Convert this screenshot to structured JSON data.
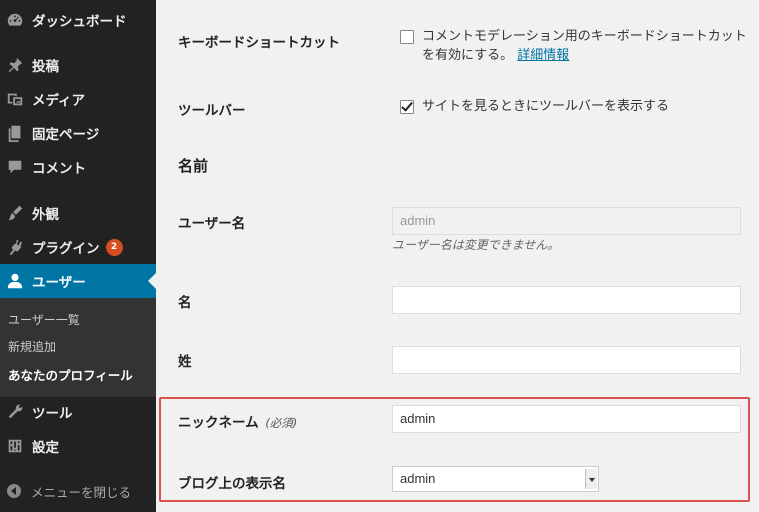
{
  "sidebar": {
    "items": [
      {
        "label": "ダッシュボード",
        "icon": "dashboard-icon"
      },
      {
        "label": "投稿",
        "icon": "pin-icon"
      },
      {
        "label": "メディア",
        "icon": "media-icon"
      },
      {
        "label": "固定ページ",
        "icon": "pages-icon"
      },
      {
        "label": "コメント",
        "icon": "comment-icon"
      },
      {
        "label": "外観",
        "icon": "appearance-icon"
      },
      {
        "label": "プラグイン",
        "icon": "plugin-icon",
        "badge": "2"
      },
      {
        "label": "ユーザー",
        "icon": "user-icon"
      },
      {
        "label": "ツール",
        "icon": "wrench-icon"
      },
      {
        "label": "設定",
        "icon": "settings-icon"
      }
    ],
    "submenu": [
      "ユーザー一覧",
      "新規追加",
      "あなたのプロフィール"
    ],
    "collapse_label": "メニューを閉じる"
  },
  "form": {
    "keyboard_shortcuts": {
      "label": "キーボードショートカット",
      "text": "コメントモデレーション用のキーボードショートカットを有効にする。",
      "link": "詳細情報",
      "checked": false
    },
    "toolbar": {
      "label": "ツールバー",
      "text": "サイトを見るときにツールバーを表示する",
      "checked": true
    },
    "name_section_title": "名前",
    "username": {
      "label": "ユーザー名",
      "value": "admin",
      "description": "ユーザー名は変更できません。"
    },
    "first_name": {
      "label": "名",
      "value": ""
    },
    "last_name": {
      "label": "姓",
      "value": ""
    },
    "nickname": {
      "label": "ニックネーム",
      "required": "(必須)",
      "value": "admin"
    },
    "display_name": {
      "label": "ブログ上の表示名",
      "value": "admin"
    }
  },
  "colors": {
    "sidebar_bg": "#222222",
    "current_menu": "#0074a2",
    "badge": "#d54e21",
    "highlight_border": "#d9534f"
  }
}
